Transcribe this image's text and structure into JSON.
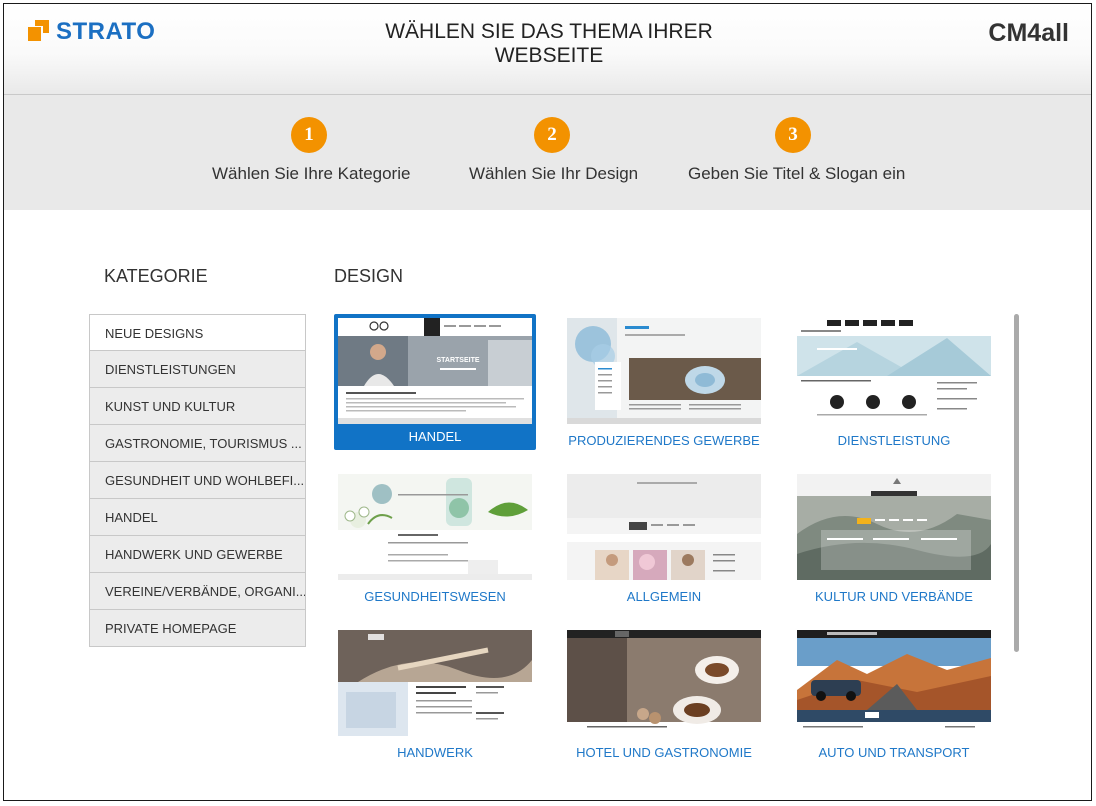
{
  "header": {
    "strato_logo": "STRATO",
    "title": "WÄHLEN SIE DAS THEMA IHRER WEBSEITE",
    "cm4all_logo": "CM4all"
  },
  "steps": [
    {
      "number": "1",
      "label": "Wählen Sie Ihre Kategorie"
    },
    {
      "number": "2",
      "label": "Wählen Sie Ihr Design"
    },
    {
      "number": "3",
      "label": "Geben Sie Titel & Slogan ein"
    }
  ],
  "categories_heading": "KATEGORIE",
  "design_heading": "DESIGN",
  "categories": [
    "NEUE DESIGNS",
    "DIENSTLEISTUNGEN",
    "KUNST UND KULTUR",
    "GASTRONOMIE, TOURISMUS ...",
    "GESUNDHEIT UND WOHLBEFI...",
    "HANDEL",
    "HANDWERK UND GEWERBE",
    "VEREINE/VERBÄNDE, ORGANI...",
    "PRIVATE HOMEPAGE"
  ],
  "selected_category": "NEUE DESIGNS",
  "designs": [
    {
      "name": "HANDEL",
      "selected": true,
      "thumb_text": "STARTSEITE"
    },
    {
      "name": "PRODUZIERENDES GEWERBE",
      "selected": false
    },
    {
      "name": "DIENSTLEISTUNG",
      "selected": false
    },
    {
      "name": "GESUNDHEITSWESEN",
      "selected": false
    },
    {
      "name": "ALLGEMEIN",
      "selected": false
    },
    {
      "name": "KULTUR UND VERBÄNDE",
      "selected": false
    },
    {
      "name": "HANDWERK",
      "selected": false
    },
    {
      "name": "HOTEL UND GASTRONOMIE",
      "selected": false
    },
    {
      "name": "AUTO UND TRANSPORT",
      "selected": false
    }
  ],
  "colors": {
    "accent": "#f39200",
    "brand_blue": "#1b6fc2",
    "selected_card": "#1173c6",
    "link": "#1f78c8"
  }
}
